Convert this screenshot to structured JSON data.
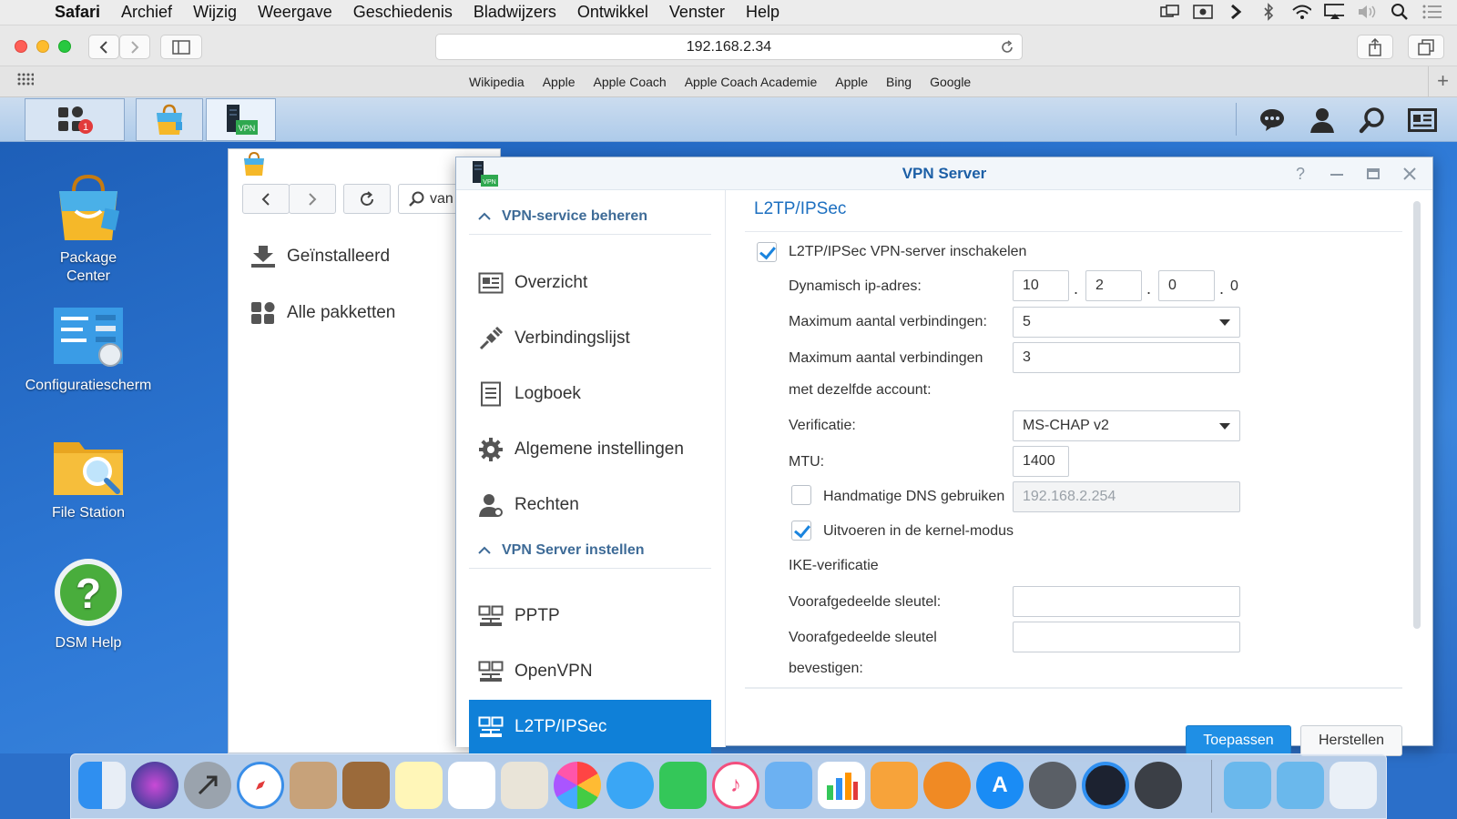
{
  "menubar": {
    "app": "Safari",
    "items": [
      "Archief",
      "Wijzig",
      "Weergave",
      "Geschiedenis",
      "Bladwijzers",
      "Ontwikkel",
      "Venster",
      "Help"
    ]
  },
  "browser": {
    "url": "192.168.2.34",
    "bookmarks": [
      "Wikipedia",
      "Apple",
      "Apple Coach",
      "Apple Coach Academie",
      "Apple",
      "Bing",
      "Google"
    ]
  },
  "dsm": {
    "taskbar": {
      "notification_badge": "1",
      "vpn_label": "VPN"
    },
    "desktop_icons": [
      {
        "label": "Package Center"
      },
      {
        "label": "Configuratiescherm"
      },
      {
        "label": "File Station"
      },
      {
        "label": "DSM Help"
      }
    ]
  },
  "package_window": {
    "search_value": "van",
    "nav": [
      "Geïnstalleerd",
      "Alle pakketten"
    ]
  },
  "vpn_window": {
    "title": "VPN Server",
    "sidebar": {
      "group1": "VPN-service beheren",
      "group1_items": [
        "Overzicht",
        "Verbindingslijst",
        "Logboek",
        "Algemene instellingen",
        "Rechten"
      ],
      "group2": "VPN Server instellen",
      "group2_items": [
        "PPTP",
        "OpenVPN",
        "L2TP/IPSec"
      ],
      "active": "L2TP/IPSec"
    },
    "content": {
      "heading": "L2TP/IPSec",
      "enable_label": "L2TP/IPSec VPN-server inschakelen",
      "enable_checked": true,
      "ip_label": "Dynamisch ip-adres:",
      "ip": [
        "10",
        "2",
        "0",
        "0"
      ],
      "max_conn_label": "Maximum aantal verbindingen:",
      "max_conn_value": "5",
      "max_same_label_1": "Maximum aantal verbindingen",
      "max_same_label_2": "met dezelfde account:",
      "max_same_value": "3",
      "auth_label": "Verificatie:",
      "auth_value": "MS-CHAP v2",
      "mtu_label": "MTU:",
      "mtu_value": "1400",
      "dns_label": "Handmatige DNS gebruiken",
      "dns_checked": false,
      "dns_value": "192.168.2.254",
      "kernel_label": "Uitvoeren in de kernel-modus",
      "kernel_checked": true,
      "ike_label": "IKE-verificatie",
      "psk_label": "Voorafgedeelde sleutel:",
      "psk_confirm_label_1": "Voorafgedeelde sleutel",
      "psk_confirm_label_2": "bevestigen:",
      "apply_label": "Toepassen",
      "reset_label": "Herstellen"
    }
  },
  "colors": {
    "accent": "#0f80d8",
    "heading": "#1c6fc0",
    "desktop": "#2e79d6"
  }
}
